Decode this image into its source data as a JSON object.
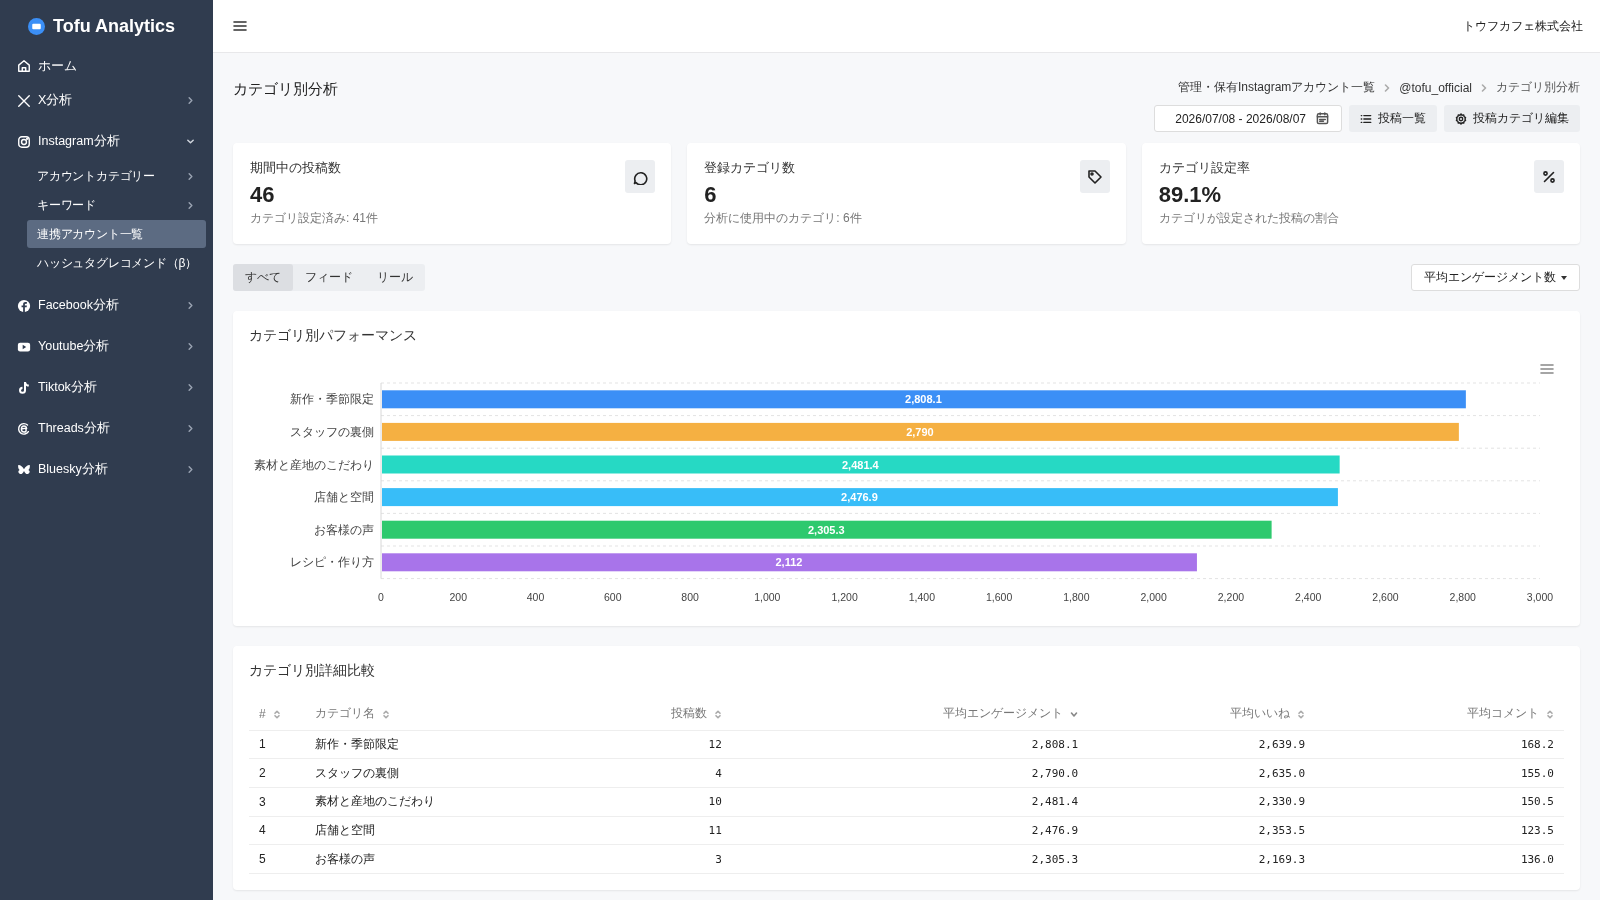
{
  "sidebar": {
    "logo": "Tofu Analytics",
    "items": [
      {
        "label": "ホーム"
      },
      {
        "label": "X分析",
        "expanded": false
      },
      {
        "label": "Instagram分析",
        "expanded": true,
        "children": [
          {
            "label": "アカウントカテゴリー",
            "selected": false,
            "has_submenu": true
          },
          {
            "label": "キーワード",
            "selected": false,
            "has_submenu": true
          },
          {
            "label": "連携アカウント一覧",
            "selected": true,
            "has_submenu": false
          },
          {
            "label": "ハッシュタグレコメンド（β）",
            "selected": false,
            "has_submenu": false
          }
        ]
      },
      {
        "label": "Facebook分析",
        "expanded": false
      },
      {
        "label": "Youtube分析",
        "expanded": false
      },
      {
        "label": "Tiktok分析",
        "expanded": false
      },
      {
        "label": "Threads分析",
        "expanded": false
      },
      {
        "label": "Bluesky分析",
        "expanded": false
      }
    ]
  },
  "header": {
    "company": "トウフカフェ株式会社"
  },
  "page": {
    "title": "カテゴリ別分析",
    "breadcrumb": [
      "管理・保有Instagramアカウント一覧",
      "@tofu_official",
      "カテゴリ別分析"
    ],
    "date_range": "2026/07/08 - 2026/08/07",
    "buttons": [
      "投稿一覧",
      "投稿カテゴリ編集"
    ]
  },
  "stats": [
    {
      "title": "期間中の投稿数",
      "value": "46",
      "note": "カテゴリ設定済み: 41件"
    },
    {
      "title": "登録カテゴリ数",
      "value": "6",
      "note": "分析に使用中のカテゴリ: 6件"
    },
    {
      "title": "カテゴリ設定率",
      "value": "89.1%",
      "note": "カテゴリが設定された投稿の割合"
    }
  ],
  "filter_tabs": [
    {
      "label": "すべて",
      "selected": true
    },
    {
      "label": "フィード",
      "selected": false
    },
    {
      "label": "リール",
      "selected": false
    }
  ],
  "metric_dropdown": "平均エンゲージメント数",
  "performance": {
    "title": "カテゴリ別パフォーマンス",
    "chart_data": {
      "type": "bar",
      "orientation": "horizontal",
      "categories": [
        "新作・季節限定",
        "スタッフの裏側",
        "素材と産地のこだわり",
        "店舗と空間",
        "お客様の声",
        "レシピ・作り方"
      ],
      "series": [
        {
          "values": [
            2808.1,
            2790,
            2481.4,
            2476.9,
            2305.3,
            2112
          ],
          "colors": [
            "#3b8ff6",
            "#f5b042",
            "#26d9c4",
            "#38bdf8",
            "#2ec96e",
            "#a874ea"
          ]
        }
      ],
      "xlim": [
        0,
        3000
      ],
      "xticks": [
        0,
        200,
        400,
        600,
        800,
        {
          "value": 1000,
          "label": "1,000"
        },
        {
          "value": 1200,
          "label": "1,200"
        },
        {
          "value": 1400,
          "label": "1,400"
        },
        {
          "value": 1600,
          "label": "1,600"
        },
        {
          "value": 1800,
          "label": "1,800"
        },
        {
          "value": 2000,
          "label": "2,000"
        },
        {
          "value": 2200,
          "label": "2,200"
        },
        {
          "value": 2400,
          "label": "2,400"
        },
        {
          "value": 2600,
          "label": "2,600"
        },
        {
          "value": 2800,
          "label": "2,800"
        },
        {
          "value": 3000,
          "label": "3,000"
        }
      ],
      "value_labels": [
        "2,808.1",
        "2,790",
        "2,481.4",
        "2,476.9",
        "2,305.3",
        "2,112"
      ]
    }
  },
  "table": {
    "title": "カテゴリ別詳細比較",
    "columns": [
      {
        "label": "#",
        "sorted": false
      },
      {
        "label": "カテゴリ名",
        "sorted": false
      },
      {
        "label": "投稿数",
        "sorted": false
      },
      {
        "label": "平均エンゲージメント",
        "sorted": true
      },
      {
        "label": "平均いいね",
        "sorted": false
      },
      {
        "label": "平均コメント",
        "sorted": false
      }
    ],
    "rows": [
      [
        "1",
        "新作・季節限定",
        "12",
        "2,808.1",
        "2,639.9",
        "168.2"
      ],
      [
        "2",
        "スタッフの裏側",
        "4",
        "2,790.0",
        "2,635.0",
        "155.0"
      ],
      [
        "3",
        "素材と産地のこだわり",
        "10",
        "2,481.4",
        "2,330.9",
        "150.5"
      ],
      [
        "4",
        "店舗と空間",
        "11",
        "2,476.9",
        "2,353.5",
        "123.5"
      ],
      [
        "5",
        "お客様の声",
        "3",
        "2,305.3",
        "2,169.3",
        "136.0"
      ]
    ]
  }
}
